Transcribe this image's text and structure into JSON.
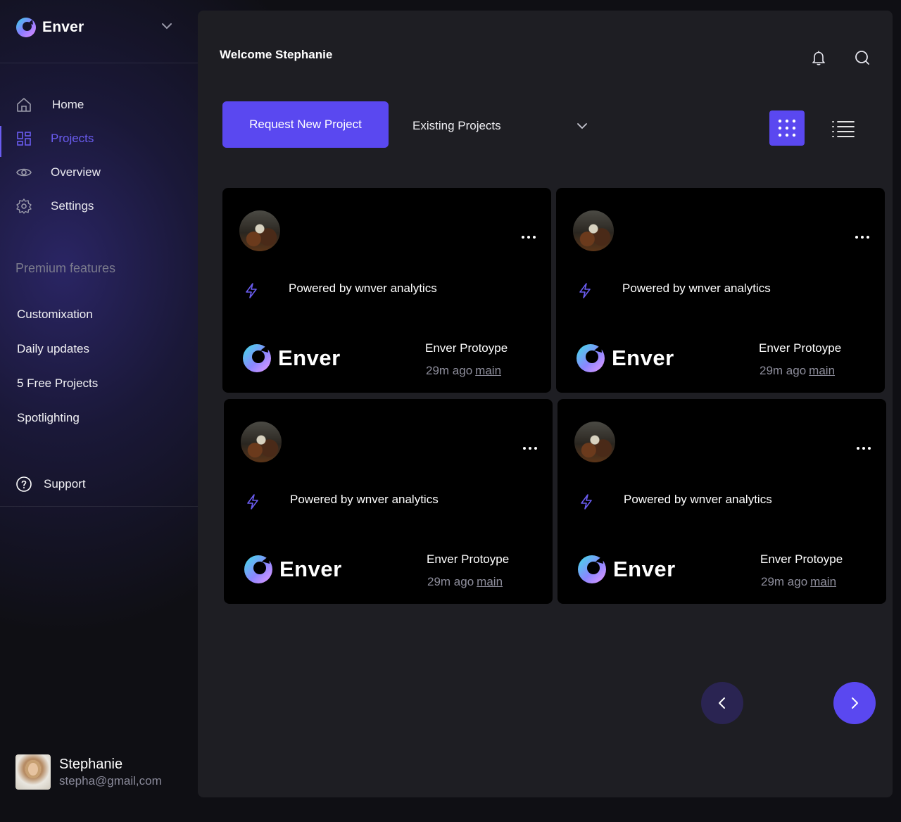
{
  "app": {
    "brand": "Enver",
    "accent_color": "#5a48f0"
  },
  "sidebar": {
    "nav": [
      {
        "label": "Home",
        "icon": "home-icon"
      },
      {
        "label": "Projects",
        "icon": "projects-icon",
        "active": true
      },
      {
        "label": "Overview",
        "icon": "eye-icon"
      },
      {
        "label": "Settings",
        "icon": "gear-icon"
      }
    ],
    "premium_title": "Premium features",
    "premium_items": [
      "Customixation",
      "Daily updates",
      "5 Free Projects",
      "Spotlighting"
    ],
    "support_label": "Support",
    "user": {
      "name": "Stephanie",
      "email": "stepha@gmail,com"
    }
  },
  "header": {
    "welcome": "Welcome Stephanie"
  },
  "toolbar": {
    "request_label": "Request New Project",
    "dropdown_value": "Existing Projects"
  },
  "cards": [
    {
      "powered": "Powered by wnver analytics",
      "logo_text": "Enver",
      "project": "Enver Protoype",
      "time": "29m ago",
      "branch": "main"
    },
    {
      "powered": "Powered by wnver analytics",
      "logo_text": "Enver",
      "project": "Enver Protoype",
      "time": "29m ago",
      "branch": "main"
    },
    {
      "powered": "Powered by wnver analytics",
      "logo_text": "Enver",
      "project": "Enver Protoype",
      "time": "29m ago",
      "branch": "main"
    },
    {
      "powered": "Powered by wnver analytics",
      "logo_text": "Enver",
      "project": "Enver Protoype",
      "time": "29m ago",
      "branch": "main"
    }
  ]
}
